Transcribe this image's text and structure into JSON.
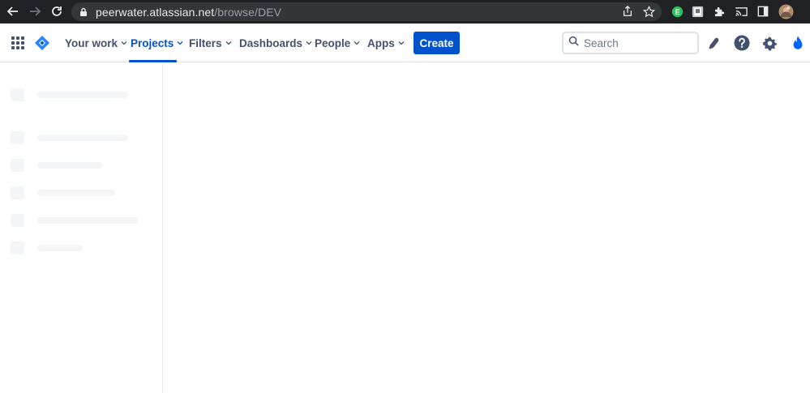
{
  "browser": {
    "url_host": "peerwater.atlassian.net",
    "url_path": "/browse/DEV",
    "extension_badge_letter": "E"
  },
  "topnav": {
    "items": [
      {
        "label": "Your work",
        "active": false
      },
      {
        "label": "Projects",
        "active": true
      },
      {
        "label": "Filters",
        "active": false
      },
      {
        "label": "Dashboards",
        "active": false
      },
      {
        "label": "People",
        "active": false
      },
      {
        "label": "Apps",
        "active": false
      }
    ],
    "create_label": "Create",
    "search_placeholder": "Search"
  },
  "colors": {
    "brand_blue": "#0052cc",
    "nav_text": "#42526e",
    "browser_bg": "#202124",
    "skeleton": "#f4f5f7"
  },
  "sidebar": {
    "state": "loading-skeleton"
  }
}
